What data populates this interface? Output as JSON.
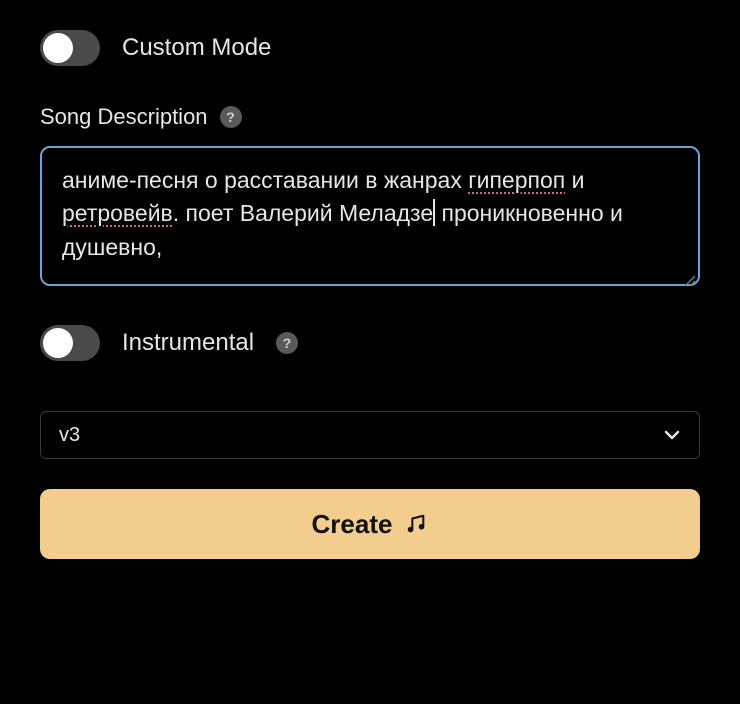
{
  "customMode": {
    "label": "Custom Mode",
    "on": false
  },
  "description": {
    "label": "Song Description",
    "text_plain": "аниме-песня о расставании в жанрах гиперпоп и ретровейв. поет Валерий Меладзе проникновенно и душевно,",
    "segments": [
      {
        "t": "аниме-песня о расставании в жанрах ",
        "err": false
      },
      {
        "t": "гиперпоп",
        "err": true
      },
      {
        "t": " и ",
        "err": false
      },
      {
        "t": "ретровейв",
        "err": true
      },
      {
        "t": ". поет Валерий Меладзе",
        "err": false
      },
      {
        "t": "",
        "caret": true
      },
      {
        "t": " проникновенно и душевно,",
        "err": false
      }
    ]
  },
  "instrumental": {
    "label": "Instrumental",
    "on": false
  },
  "model": {
    "selected": "v3"
  },
  "createBtn": {
    "label": "Create"
  }
}
